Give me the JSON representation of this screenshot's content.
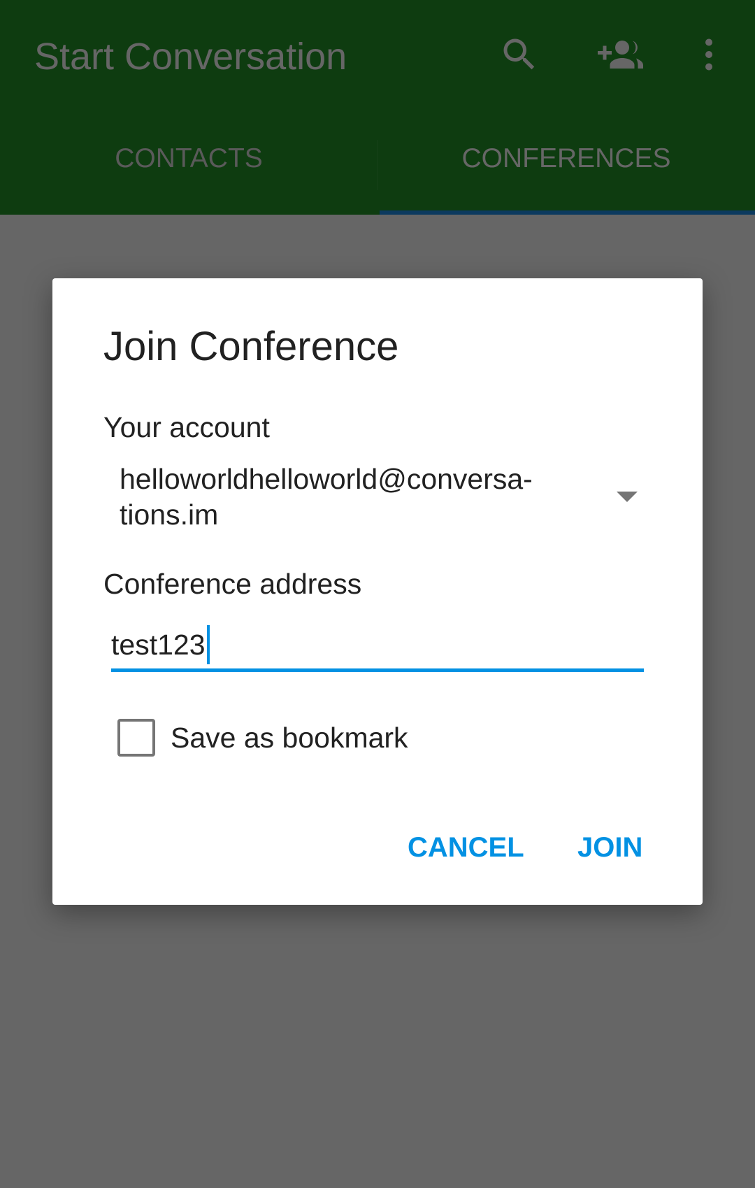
{
  "app_bar": {
    "title": "Start Conversation",
    "actions": [
      {
        "icon": "search-icon"
      },
      {
        "icon": "add-group-icon"
      },
      {
        "icon": "more-vert-icon"
      }
    ]
  },
  "tabs": [
    {
      "label": "CONTACTS",
      "selected": false
    },
    {
      "label": "CONFERENCES",
      "selected": true
    }
  ],
  "dialog": {
    "title": "Join Conference",
    "account_label": "Your account",
    "account_value": "helloworldhelloworld@conversa-tions.im",
    "address_label": "Conference address",
    "address_value": "test123",
    "bookmark_label": "Save as bookmark",
    "bookmark_checked": false,
    "cancel_label": "CANCEL",
    "join_label": "JOIN"
  },
  "colors": {
    "accent": "#0391e3",
    "primary": "#0e3c10",
    "scrim": "#666666"
  }
}
